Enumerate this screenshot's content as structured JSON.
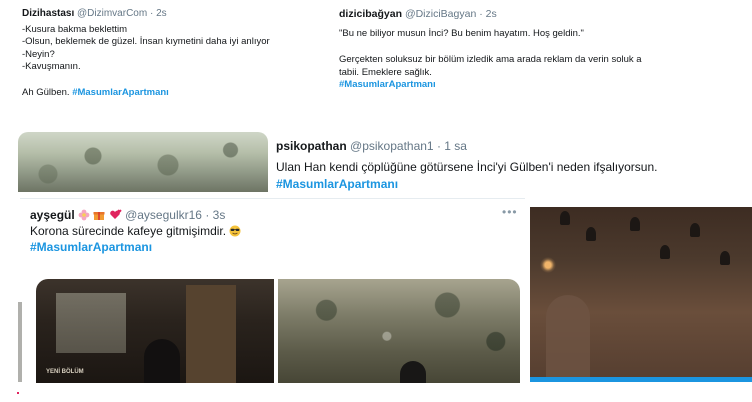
{
  "tweet1": {
    "name": "Dizihastası",
    "handle": "@DizimvarCom",
    "time": "2s",
    "lines": [
      "-Kusura bakma beklettim",
      "-Olsun, beklemek de güzel. İnsan kıymetini daha iyi anlıyor",
      "-Neyin?",
      "-Kavuşmanın."
    ],
    "closing": "Ah Gülben.",
    "hashtag": "#MasumlarApartmanı"
  },
  "tweet2": {
    "name": "dizicibağyan",
    "handle": "@DiziciBagyan",
    "time": "2s",
    "quote": "\"Bu ne biliyor musun İnci? Bu benim hayatım. Hoş geldin.\"",
    "line1": "Gerçekten soluksuz bir bölüm izledik ama arada reklam da verin soluk a",
    "line2": "tabii. Emeklere sağlık.",
    "hashtag": "#MasumlarApartmanı"
  },
  "tweet3": {
    "name": "psikopathan",
    "handle": "@psikopathan1",
    "time": "1 sa",
    "text": "Ulan Han kendi çöplüğüne götürsene İnci'yi Gülben'i neden ifşalıyorsun.",
    "hashtag": "#MasumlarApartmanı"
  },
  "tweet4": {
    "name": "ayşegül",
    "handle": "@aysegulkr16",
    "time": "3s",
    "text": "Korona sürecinde kafeye gitmişimdir.",
    "hashtag": "#MasumlarApartmanı",
    "more": "•••",
    "image_label": "YENİ BÖLÜM",
    "emoji_icons": [
      "flower-icon",
      "gift-icon",
      "hearts-icon",
      "cool-face-icon"
    ]
  },
  "sep": "·",
  "colors": {
    "hashtag": "#1b95e0",
    "handle": "#657786",
    "text": "#14171a"
  }
}
